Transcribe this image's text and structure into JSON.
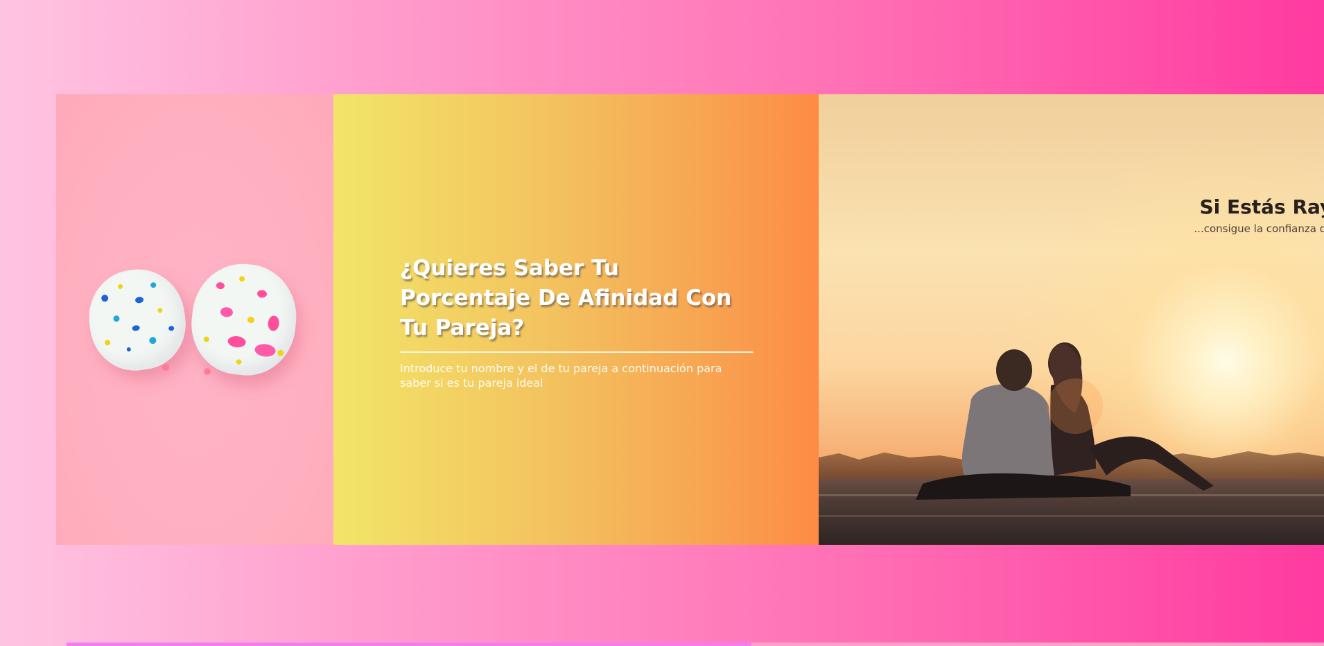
{
  "hero": {
    "title_panel": {
      "heading": "¿Quieres Saber Tu Porcentaje De Afinidad Con Tu Pareja?",
      "subtitle": "Introduce tu nombre y el de tu pareja a continuación para saber si es tu pareja ideal"
    },
    "sunset_panel": {
      "heading": "Si Estás Rayado Po",
      "subheading": "...consigue la confianza que necesitas co"
    },
    "balloon_panel": {
      "image": "heart-balloons-image"
    }
  },
  "colors": {
    "page_gradient_start": "#ffc4e1",
    "page_gradient_end": "#ff3aa0",
    "title_panel_start": "#f2e568",
    "title_panel_end": "#fe8b45",
    "balloon_panel_bg": "#ffb0c0",
    "strip_left": "#f37cf2",
    "strip_right": "#ffa2c8"
  }
}
